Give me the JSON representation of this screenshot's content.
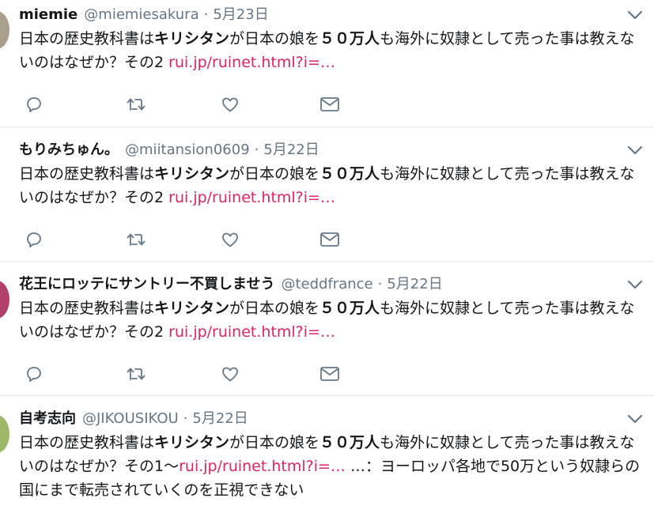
{
  "tweets": [
    {
      "name": "miemie",
      "handle": "@miemiesakura",
      "sep": "·",
      "date": "5月23日",
      "text_a": "日本の歴史教科書は",
      "text_b": "キリシタン",
      "text_c": "が日本の娘を",
      "text_d": "５０万人",
      "text_e": "も海外に奴隷として売った事は教えないのはなぜか？その2 ",
      "link": "rui.jp/ruinet.html?i=…",
      "tail": "",
      "avatar_color": "#a8a08a"
    },
    {
      "name": "もりみちゅん。",
      "handle": "@miitansion0609",
      "sep": "·",
      "date": "5月22日",
      "text_a": "日本の歴史教科書は",
      "text_b": "キリシタン",
      "text_c": "が日本の娘を",
      "text_d": "５０万人",
      "text_e": "も海外に奴隷として売った事は教えないのはなぜか？その2 ",
      "link": "rui.jp/ruinet.html?i=…",
      "tail": "",
      "avatar_color": ""
    },
    {
      "name": "花王にロッテにサントリー不買しませう",
      "handle": "@teddfrance",
      "sep": "·",
      "date": "5月22日",
      "text_a": "日本の歴史教科書は",
      "text_b": "キリシタン",
      "text_c": "が日本の娘を",
      "text_d": "５０万人",
      "text_e": "も海外に奴隷として売った事は教えないのはなぜか？その2 ",
      "link": "rui.jp/ruinet.html?i=…",
      "tail": "",
      "avatar_color": "#b2406a"
    },
    {
      "name": "自考志向",
      "handle": "@JIKOUSIKOU",
      "sep": "·",
      "date": "5月22日",
      "text_a": "日本の歴史教科書は",
      "text_b": "キリシタン",
      "text_c": "が日本の娘を",
      "text_d": "５０万人",
      "text_e": "も海外に奴隷として売った事は教えないのはなぜか？その1〜",
      "link": "rui.jp/ruinet.html?i=…",
      "tail": " …：ヨーロッパ各地で50万という奴隷らの国にまで転売されていくのを正視できない",
      "avatar_color": "#9cb868"
    }
  ],
  "colors": {
    "text": "#14171a",
    "muted": "#657786",
    "link": "#e0245e",
    "border": "#e6ecf0"
  },
  "icons": [
    "reply-icon",
    "retweet-icon",
    "like-icon",
    "message-icon",
    "caret-down-icon"
  ]
}
